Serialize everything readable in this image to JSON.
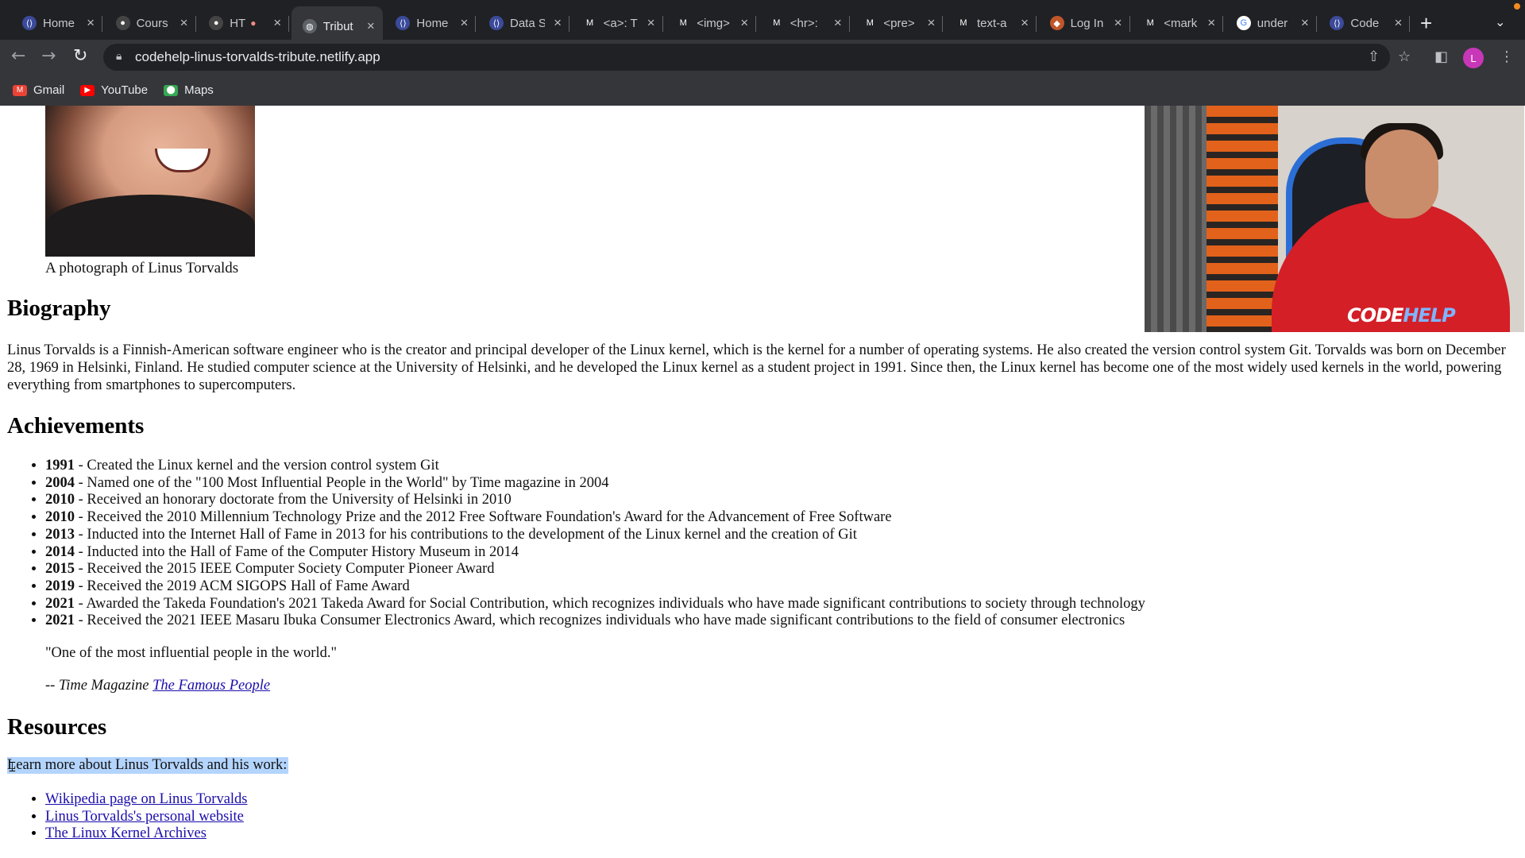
{
  "browser": {
    "tabs": [
      {
        "title": "Home",
        "favicon": "codehelp-icon",
        "active": false
      },
      {
        "title": "Cours",
        "favicon": "github-icon",
        "active": false
      },
      {
        "title": "HT",
        "favicon": "github-icon",
        "active": false,
        "recording": true
      },
      {
        "title": "Tribut",
        "favicon": "globe-icon",
        "active": true
      },
      {
        "title": "Home",
        "favicon": "codehelp-icon",
        "active": false
      },
      {
        "title": "Data S",
        "favicon": "codehelp-icon",
        "active": false
      },
      {
        "title": "<a>: T",
        "favicon": "mdn-icon",
        "active": false
      },
      {
        "title": "<img>",
        "favicon": "mdn-icon",
        "active": false
      },
      {
        "title": "<hr>:",
        "favicon": "mdn-icon",
        "active": false
      },
      {
        "title": "<pre>",
        "favicon": "mdn-icon",
        "active": false
      },
      {
        "title": "text-a",
        "favicon": "mdn-icon",
        "active": false
      },
      {
        "title": "Log In",
        "favicon": "netlify-icon",
        "active": false
      },
      {
        "title": "<mark",
        "favicon": "mdn-icon",
        "active": false
      },
      {
        "title": "under",
        "favicon": "google-icon",
        "active": false
      },
      {
        "title": "Code",
        "favicon": "codehelp-icon",
        "active": false
      }
    ],
    "url": "codehelp-linus-torvalds-tribute.netlify.app",
    "profile_initial": "L",
    "bookmarks": [
      {
        "label": "Gmail",
        "icon": "gmail-icon",
        "color": "#ea4335"
      },
      {
        "label": "YouTube",
        "icon": "youtube-icon",
        "color": "#ff0000"
      },
      {
        "label": "Maps",
        "icon": "maps-icon",
        "color": "#34a853"
      }
    ]
  },
  "page": {
    "image_caption": "A photograph of Linus Torvalds",
    "biography": {
      "heading": "Biography",
      "text": "Linus Torvalds is a Finnish-American software engineer who is the creator and principal developer of the Linux kernel, which is the kernel for a number of operating systems. He also created the version control system Git. Torvalds was born on December 28, 1969 in Helsinki, Finland. He studied computer science at the University of Helsinki, and he developed the Linux kernel as a student project in 1991. Since then, the Linux kernel has become one of the most widely used kernels in the world, powering everything from smartphones to supercomputers."
    },
    "achievements": {
      "heading": "Achievements",
      "items": [
        {
          "year": "1991",
          "text": " - Created the Linux kernel and the version control system Git"
        },
        {
          "year": "2004",
          "text": " - Named one of the \"100 Most Influential People in the World\" by Time magazine in 2004"
        },
        {
          "year": "2010",
          "text": " - Received an honorary doctorate from the University of Helsinki in 2010"
        },
        {
          "year": "2010",
          "text": " - Received the 2010 Millennium Technology Prize and the 2012 Free Software Foundation's Award for the Advancement of Free Software"
        },
        {
          "year": "2013",
          "text": " - Inducted into the Internet Hall of Fame in 2013 for his contributions to the development of the Linux kernel and the creation of Git"
        },
        {
          "year": "2014",
          "text": " - Inducted into the Hall of Fame of the Computer History Museum in 2014"
        },
        {
          "year": "2015",
          "text": " - Received the 2015 IEEE Computer Society Computer Pioneer Award"
        },
        {
          "year": "2019",
          "text": " - Received the 2019 ACM SIGOPS Hall of Fame Award"
        },
        {
          "year": "2021",
          "text": " - Awarded the Takeda Foundation's 2021 Takeda Award for Social Contribution, which recognizes individuals who have made significant contributions to society through technology"
        },
        {
          "year": "2021",
          "text": " - Received the 2021 IEEE Masaru Ibuka Consumer Electronics Award, which recognizes individuals who have made significant contributions to the field of consumer electronics"
        }
      ],
      "quote": "\"One of the most influential people in the world.\"",
      "cite_prefix": "-- Time Magazine ",
      "cite_link": "The Famous People"
    },
    "resources": {
      "heading": "Resources",
      "intro": "Learn more about Linus Torvalds and his work:",
      "links": [
        "Wikipedia page on Linus Torvalds",
        "Linus Torvalds's personal website",
        "The Linux Kernel Archives"
      ]
    },
    "webcam_brand": {
      "code": "CODE",
      "help": "HELP"
    }
  }
}
